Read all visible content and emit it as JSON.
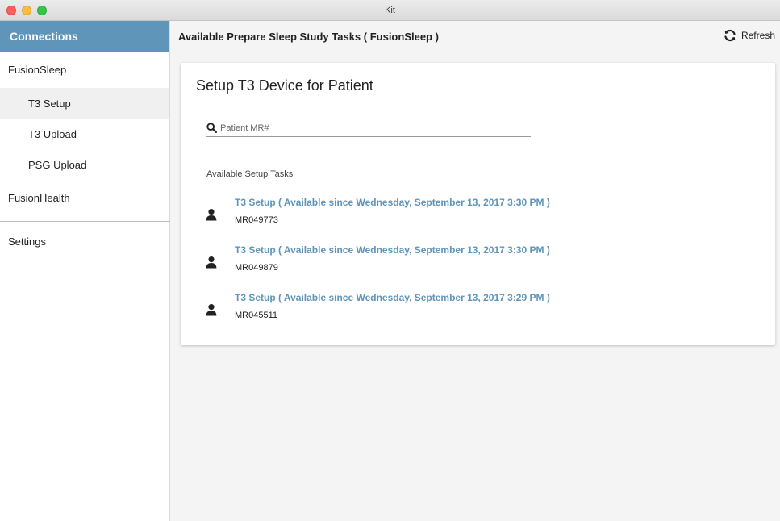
{
  "window": {
    "title": "Kit"
  },
  "sidebar": {
    "header": "Connections",
    "groups": [
      {
        "label": "FusionSleep",
        "items": [
          {
            "label": "T3 Setup",
            "active": true
          },
          {
            "label": "T3 Upload"
          },
          {
            "label": "PSG Upload"
          }
        ]
      },
      {
        "label": "FusionHealth"
      }
    ],
    "settings": "Settings"
  },
  "header": {
    "title": "Available Prepare Sleep Study Tasks ( FusionSleep )",
    "refresh_label": "Refresh"
  },
  "card": {
    "title": "Setup T3 Device for Patient",
    "search_placeholder": "Patient MR#",
    "section_label": "Available Setup Tasks",
    "tasks": [
      {
        "title": "T3 Setup ( Available since Wednesday, September 13, 2017 3:30 PM )",
        "mr": "MR049773"
      },
      {
        "title": "T3 Setup ( Available since Wednesday, September 13, 2017 3:30 PM )",
        "mr": "MR049879"
      },
      {
        "title": "T3 Setup ( Available since Wednesday, September 13, 2017 3:29 PM )",
        "mr": "MR045511"
      }
    ]
  },
  "colors": {
    "accent": "#5e95b8",
    "sidebar_active_bg": "#f0f0f0"
  },
  "icons": {
    "search": "search-icon",
    "refresh": "refresh-icon",
    "person": "person-icon"
  }
}
